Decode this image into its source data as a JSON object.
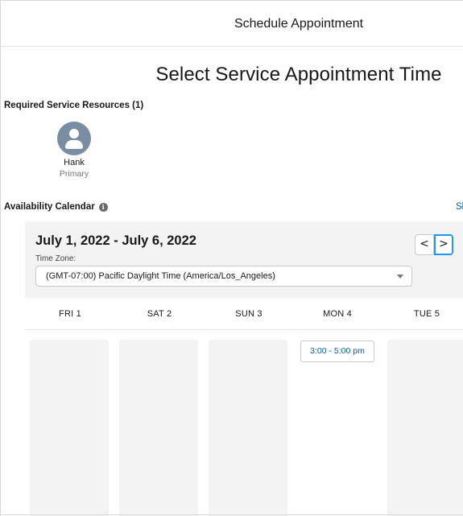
{
  "modal": {
    "title": "Schedule Appointment"
  },
  "page": {
    "heading": "Select Service Appointment Time"
  },
  "resources": {
    "label": "Required Service Resources (1)",
    "items": [
      {
        "name": "Hank",
        "role": "Primary",
        "icon": "user-avatar-icon"
      }
    ]
  },
  "availability": {
    "label": "Availability Calendar",
    "info_icon": "info-icon",
    "right_link": "Sł"
  },
  "calendar": {
    "date_range": "July 1, 2022 - July 6, 2022",
    "timezone_label": "Time Zone:",
    "timezone_value": "(GMT-07:00) Pacific Daylight Time (America/Los_Angeles)",
    "prev_icon": "chevron-left-icon",
    "next_icon": "chevron-right-icon",
    "prev_glyph": "<",
    "next_glyph": ">",
    "days": [
      {
        "label": "FRI 1",
        "slots": []
      },
      {
        "label": "SAT 2",
        "slots": []
      },
      {
        "label": "SUN 3",
        "slots": []
      },
      {
        "label": "MON 4",
        "slots": [
          "3:00 - 5:00 pm"
        ]
      },
      {
        "label": "TUE 5",
        "slots": []
      }
    ]
  },
  "colors": {
    "link": "#0b5cab",
    "panel_bg": "#f3f3f3",
    "avatar": "#7a8ea3",
    "focus": "#1b96ff"
  }
}
